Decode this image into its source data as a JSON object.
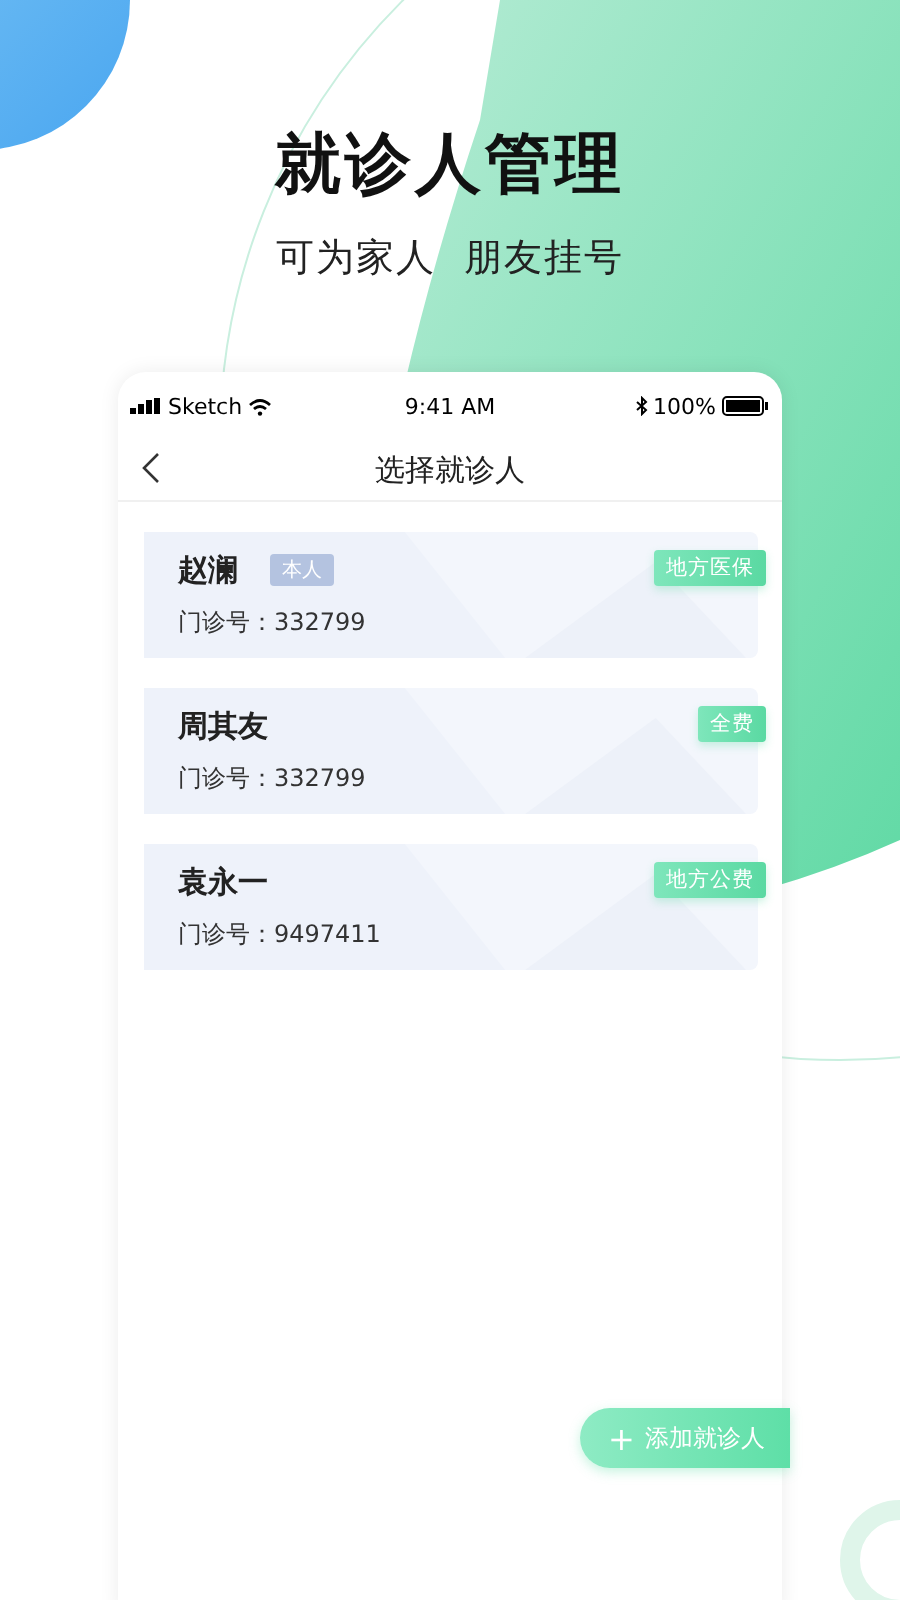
{
  "headline": {
    "title": "就诊人管理",
    "subtitle": "可为家人  朋友挂号"
  },
  "status_bar": {
    "carrier": "Sketch",
    "time": "9:41 AM",
    "battery": "100%"
  },
  "nav": {
    "title": "选择就诊人"
  },
  "patients": [
    {
      "name": "赵澜",
      "badge": "本人",
      "id_label": "门诊号：",
      "id": "332799",
      "tag": "地方医保"
    },
    {
      "name": "周其友",
      "id_label": "门诊号：",
      "id": "332799",
      "tag": "全费"
    },
    {
      "name": "袁永一",
      "id_label": "门诊号：",
      "id": "9497411",
      "tag": "地方公费"
    }
  ],
  "add_button": {
    "icon": "+",
    "label": "添加就诊人"
  }
}
